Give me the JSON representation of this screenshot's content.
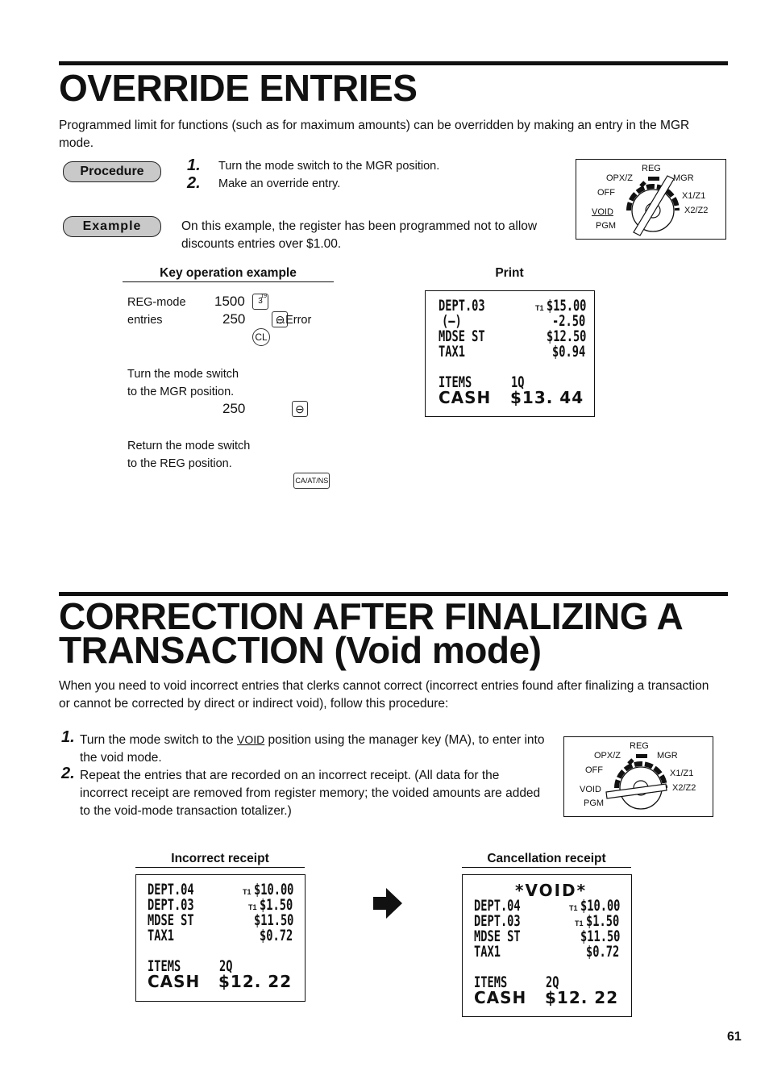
{
  "section1": {
    "title": "OVERRIDE ENTRIES",
    "intro": "Programmed limit for functions (such as for maximum amounts) can be overridden by making an entry in the MGR mode.",
    "procedure_label": "Procedure",
    "steps": [
      {
        "num": "1.",
        "text": "Turn the mode switch to the MGR position."
      },
      {
        "num": "2.",
        "text": "Make an override entry."
      }
    ],
    "example_label": "Example",
    "example_text": "On this example, the register has been programmed not to allow discounts entries over $1.00.",
    "mode_switch": {
      "labels": [
        "REG",
        "OPX/Z",
        "MGR",
        "OFF",
        "X1/Z1",
        "VOID",
        "X2/Z2",
        "PGM"
      ],
      "position": "MGR"
    },
    "key_op_header": "Key operation example",
    "print_header": "Print",
    "key_ops": {
      "reg_mode_label_1": "REG-mode",
      "reg_mode_label_2": "entries",
      "entry1_value": "1500",
      "entry1_key": "3",
      "entry1_key_sup": "19",
      "entry2_value": "250",
      "minus_key": "⊖",
      "error_text": "...Error",
      "cl_key": "CL",
      "turn_text_1": "Turn the mode switch",
      "turn_text_2": "to the MGR position.",
      "entry3_value": "250",
      "return_text_1": "Return the mode switch",
      "return_text_2": "to the REG position.",
      "ca_key": "CA/AT/NS"
    },
    "receipt": {
      "lines": [
        {
          "left": "DEPT.03",
          "tax": "T1",
          "right": "$15.00"
        },
        {
          "left": "(—)",
          "tax": "",
          "right": "-2.50"
        },
        {
          "left": "MDSE ST",
          "tax": "",
          "right": "$12.50"
        },
        {
          "left": "TAX1",
          "tax": "",
          "right": "$0.94"
        }
      ],
      "items_label": "ITEMS",
      "items_value": "1Q",
      "cash_label": "CASH",
      "cash_value": "$13. 44"
    }
  },
  "section2": {
    "title_line1": "CORRECTION AFTER FINALIZING A",
    "title_line2": "TRANSACTION  (Void mode)",
    "intro": "When you need to void incorrect entries that clerks cannot correct (incorrect entries found after finalizing a transaction or cannot be corrected by direct or indirect void), follow this procedure:",
    "step1_num": "1.",
    "step1_pre": "Turn the mode switch to the ",
    "step1_void": "VOID",
    "step1_post": " position using the manager key (MA), to enter into the void mode.",
    "step2_num": "2.",
    "step2_text": "Repeat the entries that are recorded on an incorrect receipt.  (All data for the incorrect receipt are removed from register memory; the voided amounts are added to the void-mode transaction totalizer.)",
    "mode_switch": {
      "labels": [
        "REG",
        "OPX/Z",
        "MGR",
        "OFF",
        "X1/Z1",
        "VOID",
        "X2/Z2",
        "PGM"
      ],
      "position": "VOID"
    },
    "incorrect_header": "Incorrect receipt",
    "cancel_header": "Cancellation receipt",
    "incorrect_receipt": {
      "lines": [
        {
          "left": "DEPT.04",
          "tax": "T1",
          "right": "$10.00"
        },
        {
          "left": "DEPT.03",
          "tax": "T1",
          "right": "$1.50"
        },
        {
          "left": "MDSE ST",
          "tax": "",
          "right": "$11.50"
        },
        {
          "left": "TAX1",
          "tax": "",
          "right": "$0.72"
        }
      ],
      "items_label": "ITEMS",
      "items_value": "2Q",
      "cash_label": "CASH",
      "cash_value": "$12. 22"
    },
    "cancel_receipt": {
      "void_banner": "*VOID*",
      "lines": [
        {
          "left": "DEPT.04",
          "tax": "T1",
          "right": "$10.00"
        },
        {
          "left": "DEPT.03",
          "tax": "T1",
          "right": "$1.50"
        },
        {
          "left": "MDSE ST",
          "tax": "",
          "right": "$11.50"
        },
        {
          "left": "TAX1",
          "tax": "",
          "right": "$0.72"
        }
      ],
      "items_label": "ITEMS",
      "items_value": "2Q",
      "cash_label": "CASH",
      "cash_value": "$12. 22"
    }
  },
  "page_number": "61"
}
